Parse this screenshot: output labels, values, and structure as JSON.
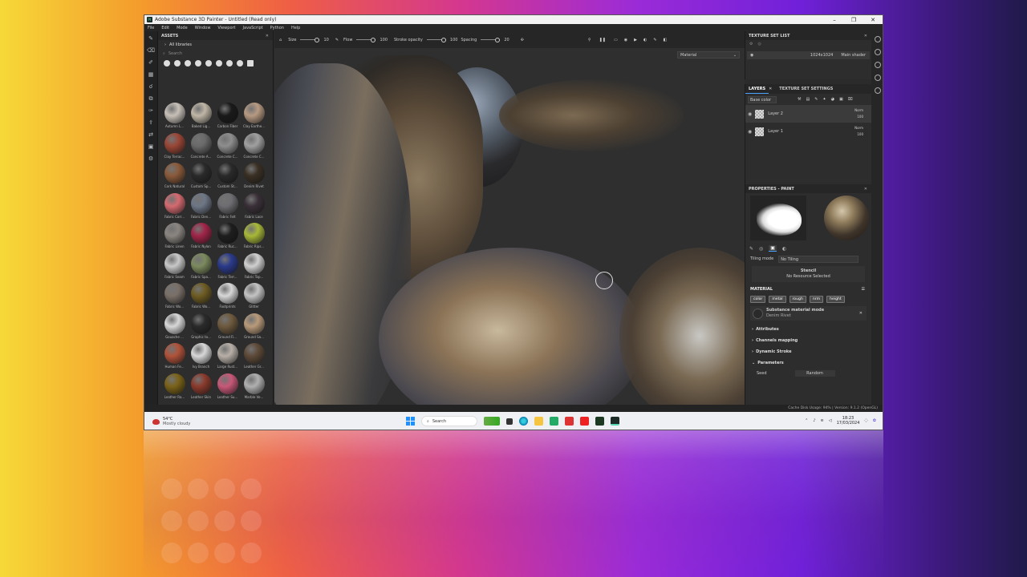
{
  "window": {
    "title": "Adobe Substance 3D Painter - Untitled (Read only)",
    "app_icon": "Pt",
    "controls": [
      "–",
      "❐",
      "✕"
    ]
  },
  "menu": [
    "File",
    "Edit",
    "Mode",
    "Window",
    "Viewport",
    "JavaScript",
    "Python",
    "Help"
  ],
  "toolbar": {
    "size_label": "Size",
    "size_value": "10",
    "flow_label": "Flow",
    "flow_value": "100",
    "stroke_opacity_label": "Stroke opacity",
    "stroke_opacity_value": "100",
    "spacing_label": "Spacing",
    "spacing_value": "20",
    "material_dropdown": "Material"
  },
  "assets": {
    "title": "ASSETS",
    "library": "All libraries",
    "search_placeholder": "Search",
    "items": [
      {
        "label": "Autumn L...",
        "color": "#c7c0b8"
      },
      {
        "label": "Baked Lig...",
        "color": "#bfb6a6"
      },
      {
        "label": "Carbon Fiber",
        "color": "#1a1a1a"
      },
      {
        "label": "Clay Earthe...",
        "color": "#b79a82"
      },
      {
        "label": "Clay Terrac...",
        "color": "#9a4636"
      },
      {
        "label": "Concrete A...",
        "color": "#6a6a6a"
      },
      {
        "label": "Concrete C...",
        "color": "#8e8e8e"
      },
      {
        "label": "Concrete C...",
        "color": "#a0a0a0"
      },
      {
        "label": "Cork Natural",
        "color": "#8a5a3a"
      },
      {
        "label": "Custom Sp...",
        "color": "#2a2a2a"
      },
      {
        "label": "Custom St...",
        "color": "#2a2a2a"
      },
      {
        "label": "Denim Rivet",
        "color": "#3a3024"
      },
      {
        "label": "Fabric Corr...",
        "color": "#d46a70"
      },
      {
        "label": "Fabric Den...",
        "color": "#6e7786"
      },
      {
        "label": "Fabric Felt",
        "color": "#6e6e72"
      },
      {
        "label": "Fabric Lace",
        "color": "#3a3038"
      },
      {
        "label": "Fabric Linen",
        "color": "#8a8580"
      },
      {
        "label": "Fabric Nylon",
        "color": "#a02448"
      },
      {
        "label": "Fabric Ruc...",
        "color": "#1e1e1e"
      },
      {
        "label": "Fabric Rips...",
        "color": "#a8b838"
      },
      {
        "label": "Fabric Seam",
        "color": "#c8c8c8"
      },
      {
        "label": "Fabric Spa...",
        "color": "#7c8a5e"
      },
      {
        "label": "Fabric Terr...",
        "color": "#2a3a8a"
      },
      {
        "label": "Fabric Top...",
        "color": "#d0d0d0"
      },
      {
        "label": "Fabric Wo...",
        "color": "#7a7068"
      },
      {
        "label": "Fabric Wo...",
        "color": "#6e5c22"
      },
      {
        "label": "Footprints",
        "color": "#d8d8d8"
      },
      {
        "label": "Glitter",
        "color": "#c4c4c4"
      },
      {
        "label": "Gouache ...",
        "color": "#d8d8d8"
      },
      {
        "label": "Graphic to...",
        "color": "#2a2a2a"
      },
      {
        "label": "Ground Fi...",
        "color": "#6e5a3e"
      },
      {
        "label": "Ground Sa...",
        "color": "#b89a7a"
      },
      {
        "label": "Human Fe...",
        "color": "#b0523a"
      },
      {
        "label": "Ivy Branch",
        "color": "#d8d8d8"
      },
      {
        "label": "Large Rust...",
        "color": "#b8b0a8"
      },
      {
        "label": "Leather Gr...",
        "color": "#5e4a38"
      },
      {
        "label": "Leather Ra...",
        "color": "#7a6218"
      },
      {
        "label": "Leather Skin",
        "color": "#8a3a2c"
      },
      {
        "label": "Leather Su...",
        "color": "#c85878"
      },
      {
        "label": "Marble Ve...",
        "color": "#b0b0b0"
      }
    ]
  },
  "texture_set_list": {
    "title": "TEXTURE SET LIST",
    "resolution": "1024x1024",
    "shader": "Main shader"
  },
  "layers": {
    "tab_layers": "LAYERS",
    "tab_settings": "TEXTURE SET SETTINGS",
    "channel": "Base color",
    "items": [
      {
        "name": "Layer 2",
        "blend": "Norm",
        "opacity": "100"
      },
      {
        "name": "Layer 1",
        "blend": "Norm",
        "opacity": "100"
      }
    ]
  },
  "properties": {
    "title": "PROPERTIES - PAINT",
    "tiling_label": "Tiling mode",
    "tiling_value": "No Tiling",
    "stencil_title": "Stencil",
    "stencil_value": "No Resource Selected",
    "material_title": "MATERIAL",
    "channels": [
      "color",
      "metal",
      "rough",
      "nrm",
      "height"
    ],
    "submat_title": "Substance material mode",
    "submat_name": "Denim Rivet",
    "sections": [
      "Attributes",
      "Channels mapping",
      "Dynamic Stroke",
      "Parameters"
    ],
    "param_label": "Seed",
    "param_value": "Random"
  },
  "status": {
    "text": "Cache Disk Usage:   94%  |  Version: 9.1.2 (OpenGL)"
  },
  "taskbar": {
    "temp": "54°C",
    "weather": "Mostly cloudy",
    "search": "Search",
    "time": "18:23",
    "date": "17/03/2024"
  }
}
